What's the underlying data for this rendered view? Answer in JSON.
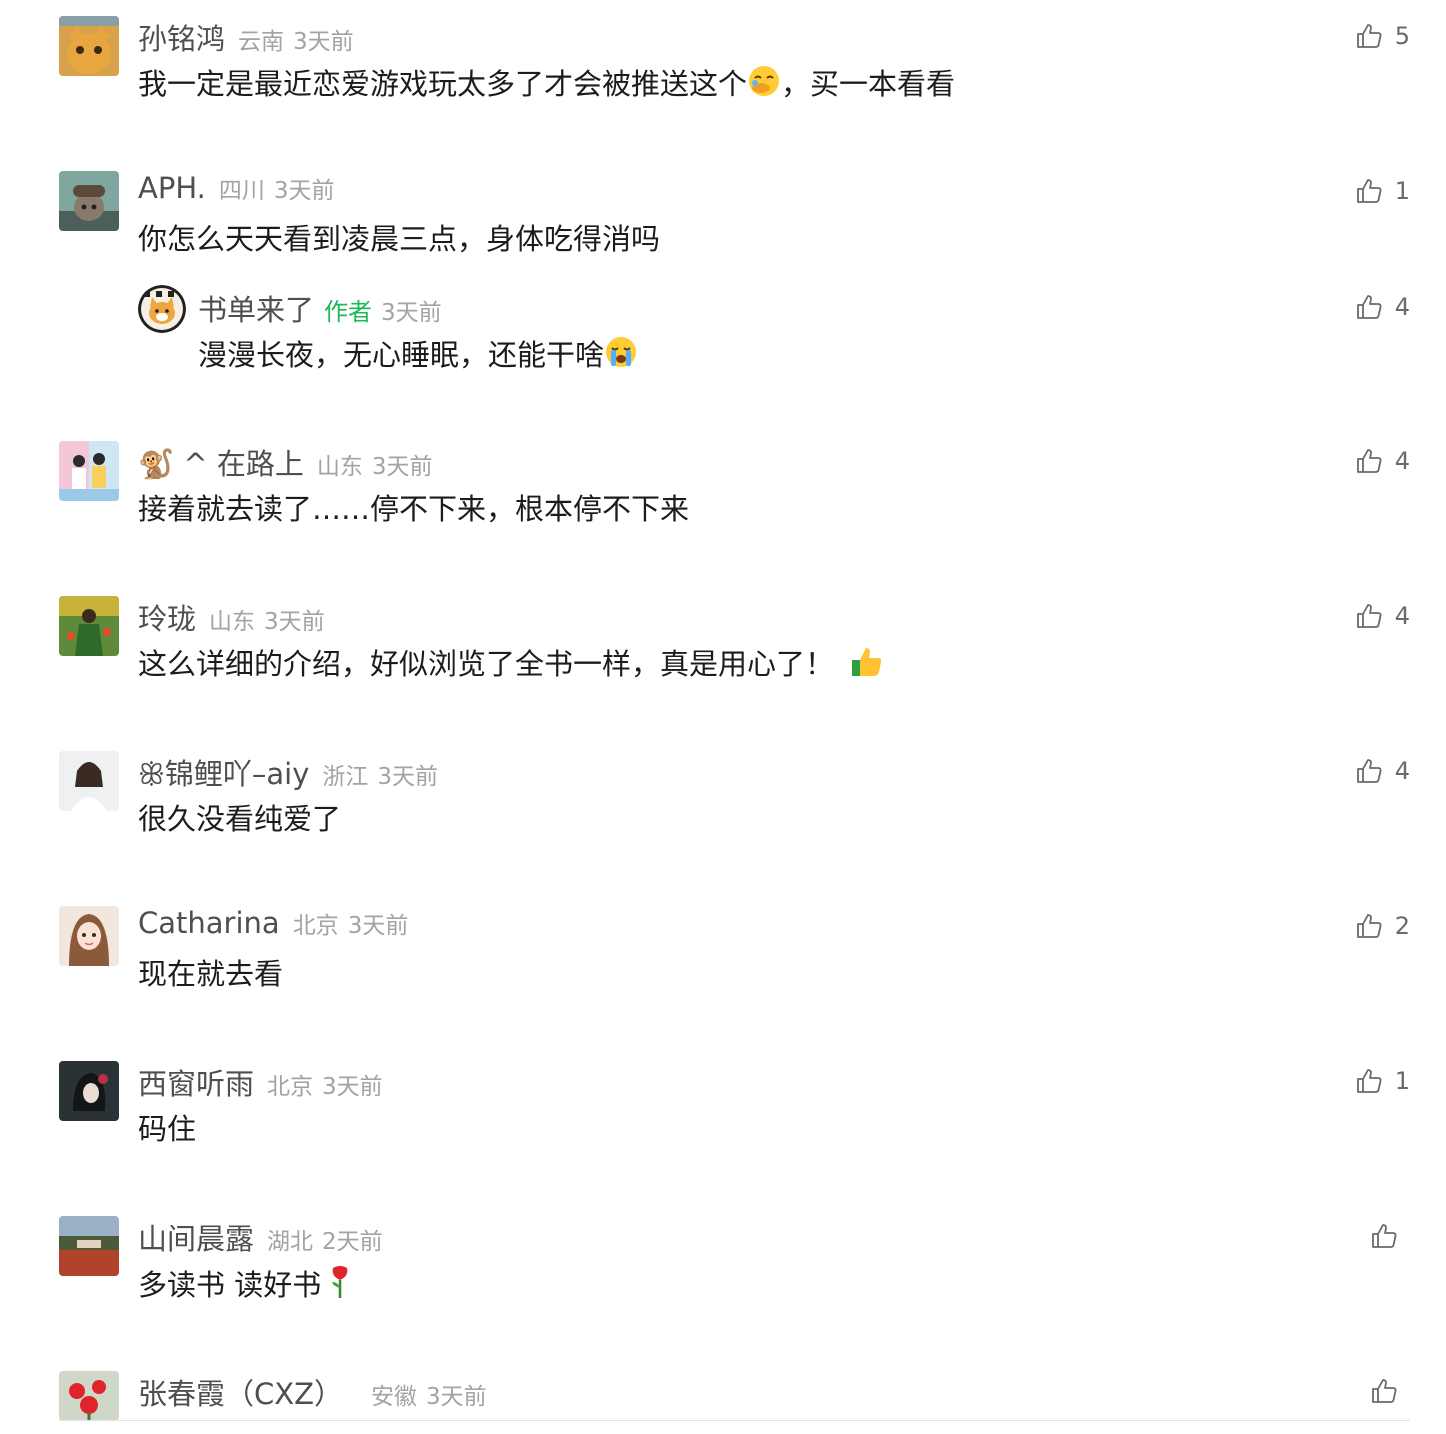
{
  "comments": [
    {
      "name": "孙铭鸿",
      "location": "云南",
      "time": "3天前",
      "text_before": "我一定是最近恋爱游戏玩太多了才会被推送这个",
      "text_after": "，买一本看看",
      "emoji": "face-with-hand-over-mouth-emoji",
      "likes": "5"
    },
    {
      "name": "APH.",
      "location": "四川",
      "time": "3天前",
      "text": "你怎么天天看到凌晨三点，身体吃得消吗",
      "likes": "1",
      "reply": {
        "name": "书单来了",
        "badge": "作者",
        "time": "3天前",
        "text": "漫漫长夜，无心睡眠，还能干啥",
        "emoji": "crying-face-emoji",
        "likes": "4"
      }
    },
    {
      "name": "🐒 ^ 在路上",
      "location": "山东",
      "time": "3天前",
      "text": "接着就去读了……停不下来，根本停不下来",
      "likes": "4"
    },
    {
      "name": "玲珑",
      "location": "山东",
      "time": "3天前",
      "text": "这么详细的介绍，好似浏览了全书一样，真是用心了！",
      "emoji": "thumbs-up-emoji",
      "likes": "4"
    },
    {
      "name": "ꕥ锦鲤吖–aiy",
      "location": "浙江",
      "time": "3天前",
      "text": "很久没看纯爱了",
      "likes": "4"
    },
    {
      "name": "Catharina",
      "location": "北京",
      "time": "3天前",
      "text": "现在就去看",
      "likes": "2"
    },
    {
      "name": "西窗听雨",
      "location": "北京",
      "time": "3天前",
      "text": "码住",
      "likes": "1"
    },
    {
      "name": "山间晨露",
      "location": "湖北",
      "time": "2天前",
      "text": "多读书 读好书",
      "emoji": "rose-emoji",
      "likes": ""
    },
    {
      "name": "张春霞（CXZ）",
      "location": "安徽",
      "time": "3天前",
      "text": "",
      "likes": ""
    }
  ],
  "colors": {
    "name": "#4f4f4f",
    "meta": "#a3a3a3",
    "author_badge": "#1db954",
    "text": "#1c1c1c"
  }
}
